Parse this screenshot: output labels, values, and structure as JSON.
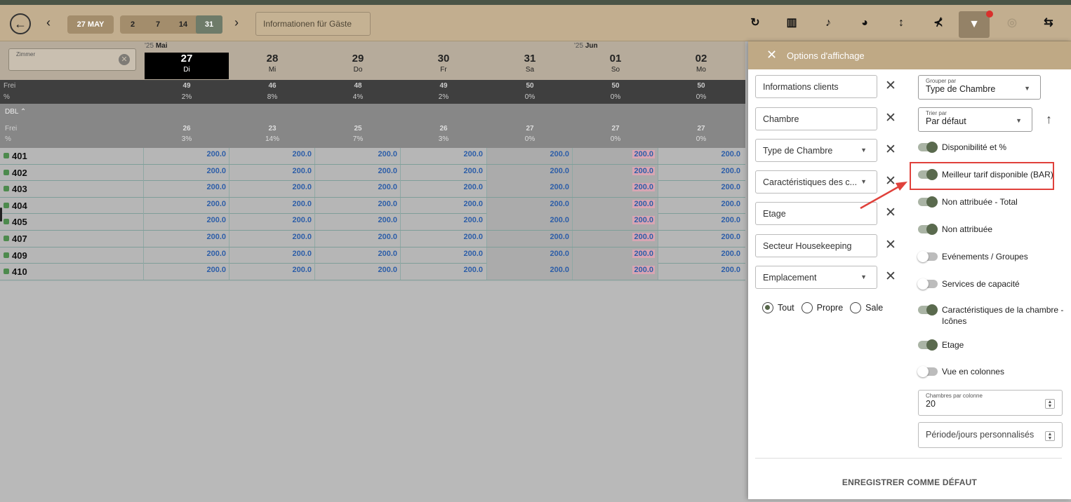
{
  "toolbar": {
    "date_label": "27 MAY",
    "ranges": [
      "2",
      "7",
      "14",
      "31"
    ],
    "active_range": "31",
    "guest_info_label": "Informationen für Gäste",
    "icons": [
      "refresh-icon",
      "columns-icon",
      "notification-add-icon",
      "palette-icon",
      "vertical-arrows-icon",
      "filter-clear-icon",
      "filter-icon",
      "focus-icon",
      "swap-layout-icon"
    ]
  },
  "calendar": {
    "month_1": {
      "year": "'25",
      "name": "Mai"
    },
    "month_2": {
      "year": "'25",
      "name": "Jun"
    },
    "search_placeholder": "Zimmer",
    "dates": [
      {
        "num": "27",
        "day": "Di"
      },
      {
        "num": "28",
        "day": "Mi"
      },
      {
        "num": "29",
        "day": "Do"
      },
      {
        "num": "30",
        "day": "Fr"
      },
      {
        "num": "31",
        "day": "Sa"
      },
      {
        "num": "01",
        "day": "So"
      },
      {
        "num": "02",
        "day": "Mo"
      }
    ],
    "frei_label": "Frei",
    "percent_label": "%",
    "total_frei": [
      "49",
      "46",
      "48",
      "49",
      "50",
      "50",
      "50"
    ],
    "total_pct": [
      "2%",
      "8%",
      "4%",
      "2%",
      "0%",
      "0%",
      "0%"
    ],
    "group_label": "DBL",
    "group_frei": [
      "26",
      "23",
      "25",
      "26",
      "27",
      "27",
      "27"
    ],
    "group_pct": [
      "3%",
      "14%",
      "7%",
      "3%",
      "0%",
      "0%",
      "0%"
    ],
    "rate": "200.0",
    "rooms": [
      "401",
      "402",
      "403",
      "404",
      "405",
      "407",
      "409",
      "410"
    ]
  },
  "panel": {
    "title": "Options d'affichage",
    "filters": [
      {
        "label": "Informations clients",
        "dropdown": false
      },
      {
        "label": "Chambre",
        "dropdown": false
      },
      {
        "label": "Type de Chambre",
        "dropdown": true
      },
      {
        "label": "Caractéristiques des c...",
        "dropdown": true
      },
      {
        "label": "Etage",
        "dropdown": false
      },
      {
        "label": "Secteur Housekeeping",
        "dropdown": false
      },
      {
        "label": "Emplacement",
        "dropdown": true
      }
    ],
    "radios": {
      "tout": "Tout",
      "propre": "Propre",
      "sale": "Sale",
      "selected": "Tout"
    },
    "group_by": {
      "caption": "Grouper par",
      "value": "Type de Chambre"
    },
    "sort_by": {
      "caption": "Trier par",
      "value": "Par défaut"
    },
    "toggles": [
      {
        "label": "Disponibilité et %",
        "on": true
      },
      {
        "label": "Meilleur tarif disponible (BAR)",
        "on": true
      },
      {
        "label": "Non attribuée - Total",
        "on": true
      },
      {
        "label": "Non attribuée",
        "on": true
      },
      {
        "label": "Evénements / Groupes",
        "on": false
      },
      {
        "label": "Services de capacité",
        "on": false
      },
      {
        "label": "Caractéristiques de la chambre - Icônes",
        "on": true
      },
      {
        "label": "Etage",
        "on": true
      },
      {
        "label": "Vue en colonnes",
        "on": false
      }
    ],
    "rooms_per_column": {
      "caption": "Chambres par colonne",
      "value": "20"
    },
    "custom_period_placeholder": "Période/jours personnalisés",
    "save_default_label": "ENREGISTRER COMME DÉFAUT"
  },
  "colors": {
    "accent": "#bfa985",
    "highlight": "#e0413b",
    "rate_text": "#2d5ea8",
    "toggle_on": "#5a6a4e"
  }
}
